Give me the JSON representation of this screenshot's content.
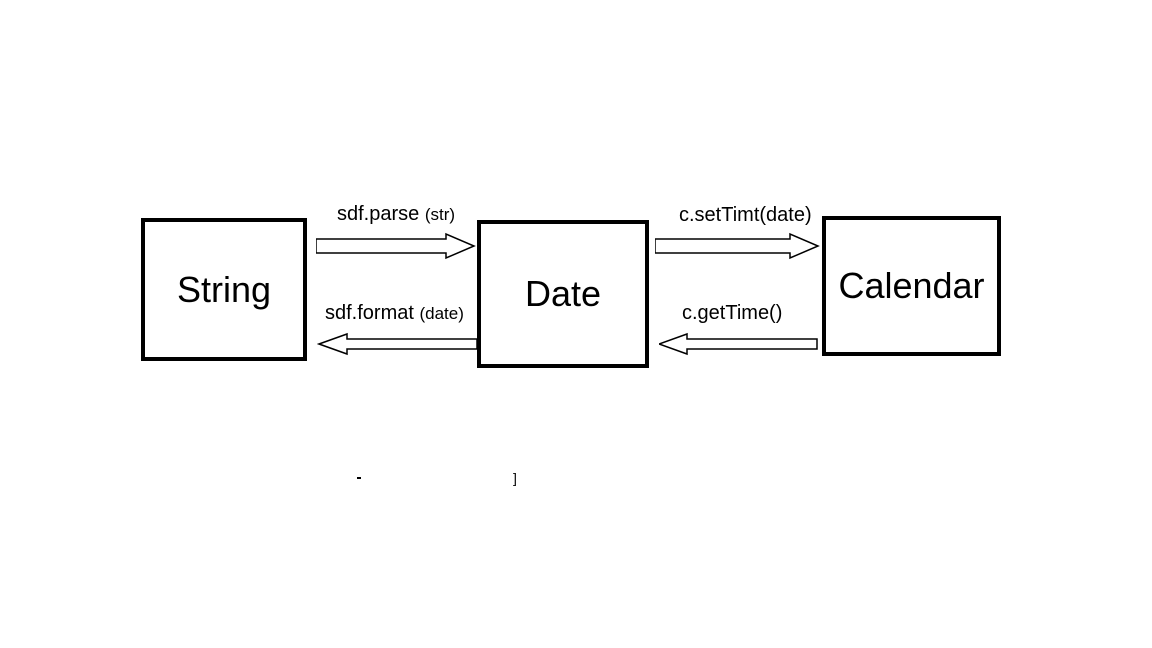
{
  "nodes": {
    "string": {
      "label": "String"
    },
    "date": {
      "label": "Date"
    },
    "calendar": {
      "label": "Calendar"
    }
  },
  "edges": {
    "string_to_date": {
      "label": "sdf.parse",
      "param": "(str)"
    },
    "date_to_string": {
      "label": "sdf.format",
      "param": "(date)"
    },
    "date_to_calendar": {
      "label": "c.setTimt(date)"
    },
    "calendar_to_date": {
      "label": "c.getTime()"
    }
  }
}
